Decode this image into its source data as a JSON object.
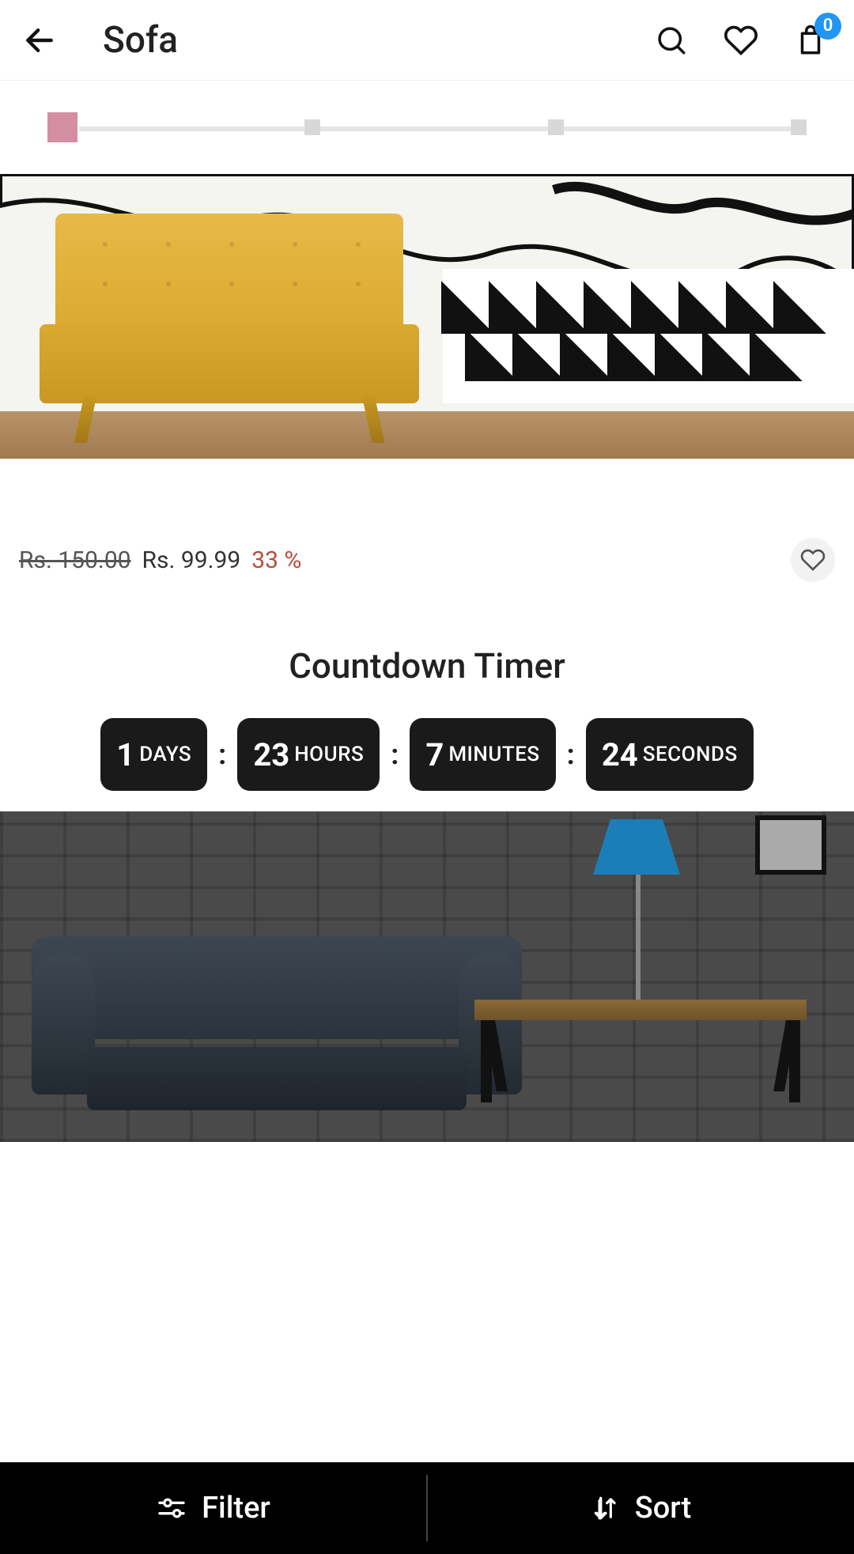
{
  "header": {
    "title": "Sofa",
    "cart_badge": "0"
  },
  "product1": {
    "price_old": "Rs. 150.00",
    "price_new": "Rs. 99.99",
    "discount": "33 %"
  },
  "countdown": {
    "title": "Countdown Timer",
    "days_num": "1",
    "days_label": "DAYS",
    "hours_num": "23",
    "hours_label": "HOURS",
    "minutes_num": "7",
    "minutes_label": "MINUTES",
    "seconds_num": "24",
    "seconds_label": "SECONDS",
    "sep": ":"
  },
  "bottom": {
    "filter": "Filter",
    "sort": "Sort"
  }
}
